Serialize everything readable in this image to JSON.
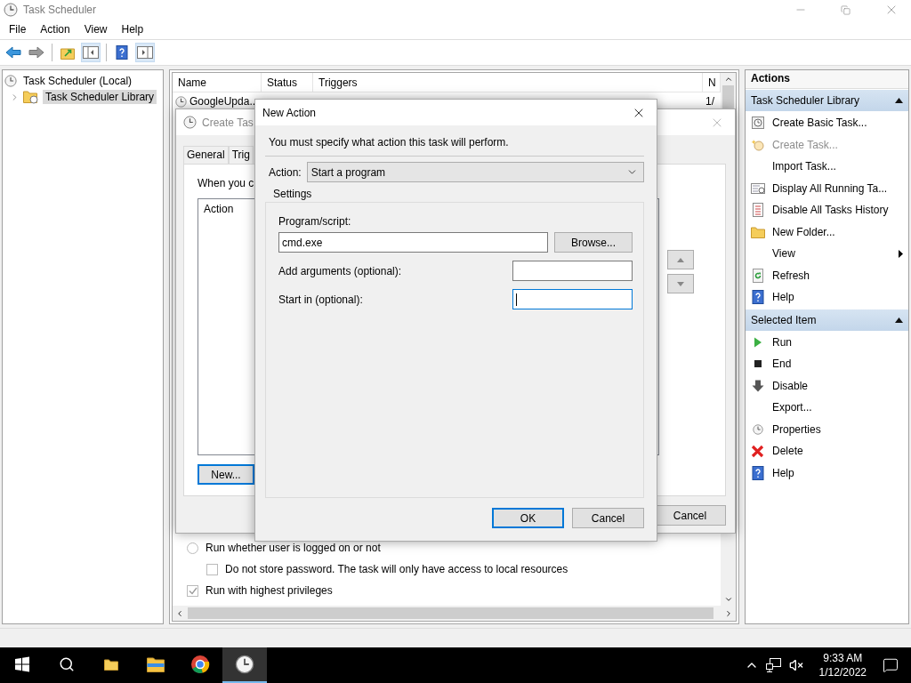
{
  "window": {
    "title": "Task Scheduler"
  },
  "menu": [
    "File",
    "Action",
    "View",
    "Help"
  ],
  "tree": [
    {
      "label": "Task Scheduler (Local)",
      "selected": false,
      "children": [
        {
          "label": "Task Scheduler Library",
          "selected": true,
          "expanded": false
        }
      ]
    }
  ],
  "task_list": {
    "columns": [
      "Name",
      "Status",
      "Triggers",
      "N"
    ],
    "rows": [
      {
        "name": "GoogleUpda..",
        "column_4": "1/"
      }
    ]
  },
  "security_options": [
    {
      "kind": "radio",
      "label": "Run whether user is logged on or not",
      "checked": false,
      "children": [
        {
          "kind": "checkbox",
          "label": "Do not store password.  The task will only have access to local resources",
          "checked": false
        }
      ]
    },
    {
      "kind": "checkbox",
      "label": "Run with highest privileges",
      "checked": true
    }
  ],
  "create_task_dialog": {
    "title": "Create Tas",
    "tabs": [
      {
        "label": "General",
        "selected": false
      },
      {
        "label": "Trig",
        "selected": false
      }
    ],
    "intro": "When you c",
    "list_header": "Action",
    "new_button": "New...",
    "cancel_button": "Cancel"
  },
  "new_action_dialog": {
    "title": "New Action",
    "instruction": "You must specify what action this task will perform.",
    "action_label": "Action:",
    "action_value": "Start a program",
    "settings_label": "Settings",
    "fields": [
      {
        "kind": "stacked",
        "label": "Program/script:",
        "value": "cmd.exe",
        "button": "Browse...",
        "focused": false
      },
      {
        "kind": "inline",
        "label": "Add arguments (optional):",
        "focused": false
      },
      {
        "kind": "inline",
        "label": "Start in (optional):",
        "focused": true
      }
    ],
    "buttons": [
      {
        "label": "OK",
        "default": true
      },
      {
        "label": "Cancel",
        "default": false
      }
    ]
  },
  "actions_pane": {
    "title": "Actions",
    "sections": [
      {
        "title": "Task Scheduler Library",
        "expanded": true,
        "items": [
          {
            "label": "Create Basic Task...",
            "disabled": false,
            "submenu": false
          },
          {
            "label": "Create Task...",
            "disabled": true,
            "submenu": false
          },
          {
            "label": "Import Task...",
            "disabled": false,
            "submenu": false
          },
          {
            "label": "Display All Running Ta...",
            "disabled": false,
            "submenu": false
          },
          {
            "label": "Disable All Tasks History",
            "disabled": false,
            "submenu": false
          },
          {
            "label": "New Folder...",
            "disabled": false,
            "submenu": false
          },
          {
            "label": "View",
            "disabled": false,
            "submenu": true
          },
          {
            "label": "Refresh",
            "disabled": false,
            "submenu": false
          },
          {
            "label": "Help",
            "disabled": false,
            "submenu": false
          }
        ]
      },
      {
        "title": "Selected Item",
        "expanded": true,
        "items": [
          {
            "label": "Run",
            "disabled": false,
            "submenu": false
          },
          {
            "label": "End",
            "disabled": false,
            "submenu": false
          },
          {
            "label": "Disable",
            "disabled": false,
            "submenu": false
          },
          {
            "label": "Export...",
            "disabled": false,
            "submenu": false
          },
          {
            "label": "Properties",
            "disabled": false,
            "submenu": false
          },
          {
            "label": "Delete",
            "disabled": false,
            "submenu": false
          },
          {
            "label": "Help",
            "disabled": false,
            "submenu": false
          }
        ]
      }
    ]
  },
  "taskbar": {
    "apps": [
      {
        "active": false
      },
      {
        "active": false
      },
      {
        "active": true
      }
    ],
    "time": "9:33 AM",
    "date": "1/12/2022"
  }
}
